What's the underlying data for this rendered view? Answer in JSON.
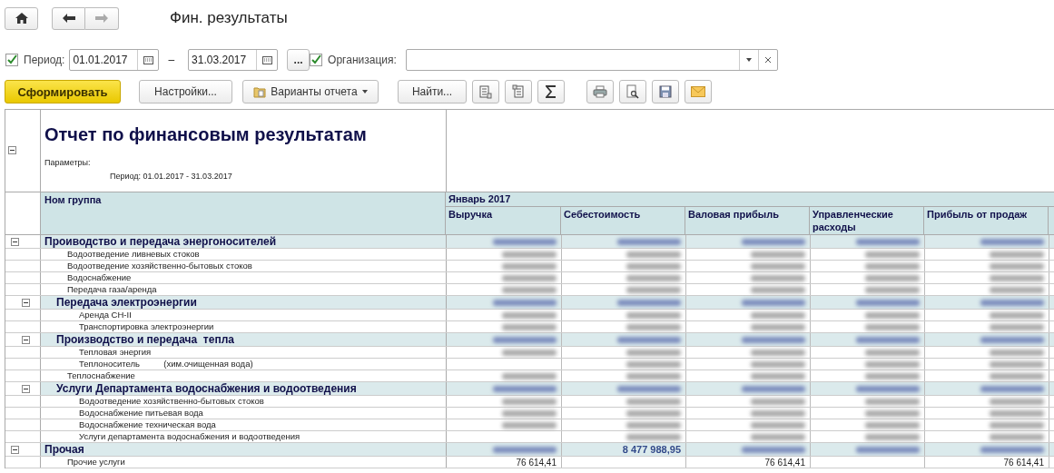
{
  "nav": {
    "forward_disabled": true
  },
  "window": {
    "title": "Фин. результаты"
  },
  "filters": {
    "period_checked": true,
    "period_label": "Период:",
    "date_from": "01.01.2017",
    "dash": "–",
    "date_to": "31.03.2017",
    "more": "...",
    "org_checked": true,
    "org_label": "Организация:"
  },
  "toolbar": {
    "generate": "Сформировать",
    "settings": "Настройки...",
    "variants": "Варианты отчета",
    "find": "Найти..."
  },
  "report": {
    "title": "Отчет по финансовым результатам",
    "params_label": "Параметры:",
    "params": "Период: 01.01.2017 - 31.03.2017",
    "group_header": "Ном группа",
    "period_header": "Январь 2017",
    "columns": [
      "Выручка",
      "Себестоимость",
      "Валовая прибыль",
      "Управленческие расходы",
      "Прибыль от продаж"
    ],
    "rows": [
      {
        "kind": "group",
        "label": "Проиводство и передача энергоносителей",
        "expanded": true,
        "cells": [
          {
            "kind": "blurred"
          },
          {
            "kind": "blurred"
          },
          {
            "kind": "blurred"
          },
          {
            "kind": "blurred"
          },
          {
            "kind": "blurred"
          }
        ],
        "children": [
          {
            "kind": "item",
            "label": "Водоотведение ливневых стоков",
            "cells": [
              {
                "kind": "blurred"
              },
              {
                "kind": "blurred"
              },
              {
                "kind": "blurred"
              },
              {
                "kind": "blurred"
              },
              {
                "kind": "blurred"
              }
            ]
          },
          {
            "kind": "item",
            "label": "Водоотведение хозяйственно-бытовых стоков",
            "cells": [
              {
                "kind": "blurred"
              },
              {
                "kind": "blurred"
              },
              {
                "kind": "blurred"
              },
              {
                "kind": "blurred"
              },
              {
                "kind": "blurred"
              }
            ]
          },
          {
            "kind": "item",
            "label": "Водоснабжение",
            "cells": [
              {
                "kind": "blurred"
              },
              {
                "kind": "blurred"
              },
              {
                "kind": "blurred"
              },
              {
                "kind": "blurred"
              },
              {
                "kind": "blurred"
              }
            ]
          },
          {
            "kind": "item",
            "label": "Передача газа/аренда",
            "cells": [
              {
                "kind": "blurred"
              },
              {
                "kind": "blurred"
              },
              {
                "kind": "blurred"
              },
              {
                "kind": "blurred"
              },
              {
                "kind": "blurred"
              }
            ]
          },
          {
            "kind": "group",
            "label": "Передача электроэнергии",
            "expanded": true,
            "cells": [
              {
                "kind": "blurred"
              },
              {
                "kind": "blurred"
              },
              {
                "kind": "blurred"
              },
              {
                "kind": "blurred"
              },
              {
                "kind": "blurred"
              }
            ],
            "children": [
              {
                "kind": "item",
                "label": "Аренда СН-II",
                "cells": [
                  {
                    "kind": "blurred"
                  },
                  {
                    "kind": "blurred"
                  },
                  {
                    "kind": "blurred"
                  },
                  {
                    "kind": "blurred"
                  },
                  {
                    "kind": "blurred"
                  }
                ]
              },
              {
                "kind": "item",
                "label": "Транспортировка электроэнергии",
                "cells": [
                  {
                    "kind": "blurred"
                  },
                  {
                    "kind": "blurred"
                  },
                  {
                    "kind": "blurred"
                  },
                  {
                    "kind": "blurred"
                  },
                  {
                    "kind": "blurred"
                  }
                ]
              }
            ]
          },
          {
            "kind": "group",
            "label": "Производство и передача  тепла",
            "expanded": true,
            "cells": [
              {
                "kind": "blurred"
              },
              {
                "kind": "blurred"
              },
              {
                "kind": "blurred"
              },
              {
                "kind": "blurred"
              },
              {
                "kind": "blurred"
              }
            ],
            "children": [
              {
                "kind": "item",
                "label": "Тепловая энергия",
                "cells": [
                  {
                    "kind": "blurred"
                  },
                  {
                    "kind": "blurred"
                  },
                  {
                    "kind": "blurred"
                  },
                  {
                    "kind": "blurred"
                  },
                  {
                    "kind": "blurred"
                  }
                ]
              },
              {
                "kind": "item",
                "label": "Теплоноситель          (хим.очищенная вода)",
                "cells": [
                  {
                    "kind": "blank"
                  },
                  {
                    "kind": "blurred"
                  },
                  {
                    "kind": "blurred"
                  },
                  {
                    "kind": "blurred"
                  },
                  {
                    "kind": "blurred"
                  }
                ]
              }
            ]
          },
          {
            "kind": "item",
            "label": "Теплоснабжение",
            "cells": [
              {
                "kind": "blurred"
              },
              {
                "kind": "blurred"
              },
              {
                "kind": "blurred"
              },
              {
                "kind": "blurred"
              },
              {
                "kind": "blurred"
              }
            ]
          },
          {
            "kind": "group",
            "label": "Услуги Департамента водоснабжения и водоотведения",
            "expanded": true,
            "cells": [
              {
                "kind": "blurred"
              },
              {
                "kind": "blurred"
              },
              {
                "kind": "blurred"
              },
              {
                "kind": "blurred"
              },
              {
                "kind": "blurred"
              }
            ],
            "children": [
              {
                "kind": "item",
                "label": "Водоотведение хозяйственно-бытовых стоков",
                "cells": [
                  {
                    "kind": "blurred"
                  },
                  {
                    "kind": "blurred"
                  },
                  {
                    "kind": "blurred"
                  },
                  {
                    "kind": "blurred"
                  },
                  {
                    "kind": "blurred"
                  }
                ]
              },
              {
                "kind": "item",
                "label": "Водоснабжение питьевая вода",
                "cells": [
                  {
                    "kind": "blurred"
                  },
                  {
                    "kind": "blurred"
                  },
                  {
                    "kind": "blurred"
                  },
                  {
                    "kind": "blurred"
                  },
                  {
                    "kind": "blurred"
                  }
                ]
              },
              {
                "kind": "item",
                "label": "Водоснабжение техническая вода",
                "cells": [
                  {
                    "kind": "blurred"
                  },
                  {
                    "kind": "blurred"
                  },
                  {
                    "kind": "blurred"
                  },
                  {
                    "kind": "blurred"
                  },
                  {
                    "kind": "blurred"
                  }
                ]
              },
              {
                "kind": "item",
                "label": "Услуги департамента водоснабжения и водоотведения",
                "cells": [
                  {
                    "kind": "blank"
                  },
                  {
                    "kind": "blurred"
                  },
                  {
                    "kind": "blurred"
                  },
                  {
                    "kind": "blurred"
                  },
                  {
                    "kind": "blurred"
                  }
                ]
              }
            ]
          }
        ]
      },
      {
        "kind": "group",
        "label": "Прочая",
        "expanded": true,
        "cells": [
          {
            "kind": "blurred"
          },
          {
            "kind": "text",
            "text": "8 477 988,95"
          },
          {
            "kind": "blurred"
          },
          {
            "kind": "blurred"
          },
          {
            "kind": "blurred"
          }
        ],
        "children": [
          {
            "kind": "item",
            "label": "Прочие услуги",
            "cells": [
              {
                "kind": "text",
                "text": "76 614,41"
              },
              {
                "kind": "blank"
              },
              {
                "kind": "text",
                "text": "76 614,41"
              },
              {
                "kind": "blank"
              },
              {
                "kind": "text",
                "text": "76 614,41"
              }
            ]
          }
        ]
      }
    ]
  }
}
